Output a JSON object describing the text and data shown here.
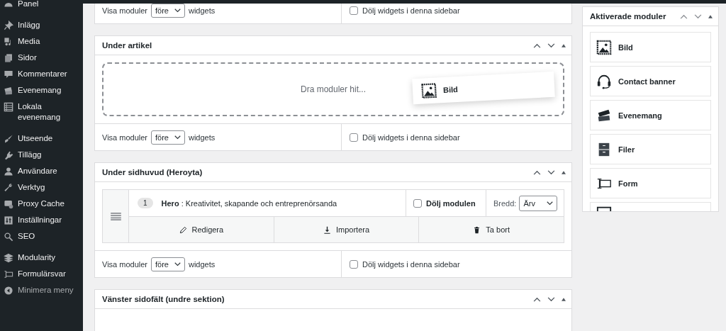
{
  "menu": {
    "groups": [
      {
        "items": [
          {
            "label": "Panel"
          }
        ]
      },
      {
        "items": [
          {
            "label": "Inlägg"
          },
          {
            "label": "Media"
          },
          {
            "label": "Sidor"
          },
          {
            "label": "Kommentarer"
          },
          {
            "label": "Evenemang"
          },
          {
            "label": "Lokala evenemang"
          }
        ]
      },
      {
        "items": [
          {
            "label": "Utseende"
          },
          {
            "label": "Tillägg"
          },
          {
            "label": "Användare"
          },
          {
            "label": "Verktyg"
          },
          {
            "label": "Proxy Cache"
          },
          {
            "label": "Inställningar"
          },
          {
            "label": "SEO"
          }
        ]
      },
      {
        "items": [
          {
            "label": "Modularity"
          },
          {
            "label": "Formulärsvar"
          }
        ]
      }
    ],
    "collapse": "Minimera meny"
  },
  "sections": [
    {
      "kind": "partial",
      "footer": {
        "show_label": "Visa moduler",
        "position": "före",
        "widgets_label": "widgets",
        "hide_label": "Dölj widgets i denna sidebar",
        "hide_checked": false
      }
    },
    {
      "kind": "dropzone",
      "title": "Under artikel",
      "dropzone_text": "Dra moduler hit...",
      "dragged_module": "Bild",
      "footer": {
        "show_label": "Visa moduler",
        "position": "före",
        "widgets_label": "widgets",
        "hide_label": "Dölj widgets i denna sidebar",
        "hide_checked": false
      }
    },
    {
      "kind": "modules",
      "title": "Under sidhuvud (Heroyta)",
      "modules": [
        {
          "number": "1",
          "name": "Hero",
          "description": ": Kreativitet, skapande och entreprenörsanda",
          "hide_label": "Dölj modulen",
          "hide_checked": false,
          "width_label": "Bredd:",
          "width_value": "Ärv",
          "actions": [
            "Redigera",
            "Importera",
            "Ta bort"
          ]
        }
      ],
      "footer": {
        "show_label": "Visa moduler",
        "position": "före",
        "widgets_label": "widgets",
        "hide_label": "Dölj widgets i denna sidebar",
        "hide_checked": false
      }
    },
    {
      "kind": "empty",
      "title": "Vänster sidofält (undre sektion)"
    }
  ],
  "available": {
    "title": "Aktiverade moduler",
    "modules": [
      {
        "label": "Bild"
      },
      {
        "label": "Contact banner"
      },
      {
        "label": "Evenemang"
      },
      {
        "label": "Filer"
      },
      {
        "label": "Form"
      }
    ]
  }
}
